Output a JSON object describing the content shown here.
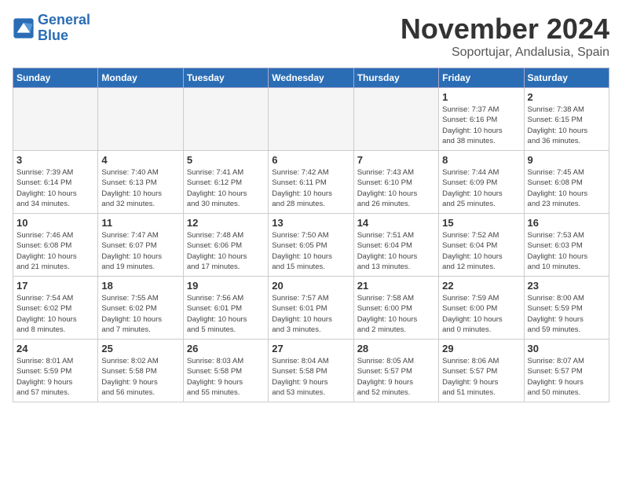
{
  "header": {
    "logo_line1": "General",
    "logo_line2": "Blue",
    "month": "November 2024",
    "location": "Soportujar, Andalusia, Spain"
  },
  "days_of_week": [
    "Sunday",
    "Monday",
    "Tuesday",
    "Wednesday",
    "Thursday",
    "Friday",
    "Saturday"
  ],
  "weeks": [
    [
      {
        "day": "",
        "info": ""
      },
      {
        "day": "",
        "info": ""
      },
      {
        "day": "",
        "info": ""
      },
      {
        "day": "",
        "info": ""
      },
      {
        "day": "",
        "info": ""
      },
      {
        "day": "1",
        "info": "Sunrise: 7:37 AM\nSunset: 6:16 PM\nDaylight: 10 hours\nand 38 minutes."
      },
      {
        "day": "2",
        "info": "Sunrise: 7:38 AM\nSunset: 6:15 PM\nDaylight: 10 hours\nand 36 minutes."
      }
    ],
    [
      {
        "day": "3",
        "info": "Sunrise: 7:39 AM\nSunset: 6:14 PM\nDaylight: 10 hours\nand 34 minutes."
      },
      {
        "day": "4",
        "info": "Sunrise: 7:40 AM\nSunset: 6:13 PM\nDaylight: 10 hours\nand 32 minutes."
      },
      {
        "day": "5",
        "info": "Sunrise: 7:41 AM\nSunset: 6:12 PM\nDaylight: 10 hours\nand 30 minutes."
      },
      {
        "day": "6",
        "info": "Sunrise: 7:42 AM\nSunset: 6:11 PM\nDaylight: 10 hours\nand 28 minutes."
      },
      {
        "day": "7",
        "info": "Sunrise: 7:43 AM\nSunset: 6:10 PM\nDaylight: 10 hours\nand 26 minutes."
      },
      {
        "day": "8",
        "info": "Sunrise: 7:44 AM\nSunset: 6:09 PM\nDaylight: 10 hours\nand 25 minutes."
      },
      {
        "day": "9",
        "info": "Sunrise: 7:45 AM\nSunset: 6:08 PM\nDaylight: 10 hours\nand 23 minutes."
      }
    ],
    [
      {
        "day": "10",
        "info": "Sunrise: 7:46 AM\nSunset: 6:08 PM\nDaylight: 10 hours\nand 21 minutes."
      },
      {
        "day": "11",
        "info": "Sunrise: 7:47 AM\nSunset: 6:07 PM\nDaylight: 10 hours\nand 19 minutes."
      },
      {
        "day": "12",
        "info": "Sunrise: 7:48 AM\nSunset: 6:06 PM\nDaylight: 10 hours\nand 17 minutes."
      },
      {
        "day": "13",
        "info": "Sunrise: 7:50 AM\nSunset: 6:05 PM\nDaylight: 10 hours\nand 15 minutes."
      },
      {
        "day": "14",
        "info": "Sunrise: 7:51 AM\nSunset: 6:04 PM\nDaylight: 10 hours\nand 13 minutes."
      },
      {
        "day": "15",
        "info": "Sunrise: 7:52 AM\nSunset: 6:04 PM\nDaylight: 10 hours\nand 12 minutes."
      },
      {
        "day": "16",
        "info": "Sunrise: 7:53 AM\nSunset: 6:03 PM\nDaylight: 10 hours\nand 10 minutes."
      }
    ],
    [
      {
        "day": "17",
        "info": "Sunrise: 7:54 AM\nSunset: 6:02 PM\nDaylight: 10 hours\nand 8 minutes."
      },
      {
        "day": "18",
        "info": "Sunrise: 7:55 AM\nSunset: 6:02 PM\nDaylight: 10 hours\nand 7 minutes."
      },
      {
        "day": "19",
        "info": "Sunrise: 7:56 AM\nSunset: 6:01 PM\nDaylight: 10 hours\nand 5 minutes."
      },
      {
        "day": "20",
        "info": "Sunrise: 7:57 AM\nSunset: 6:01 PM\nDaylight: 10 hours\nand 3 minutes."
      },
      {
        "day": "21",
        "info": "Sunrise: 7:58 AM\nSunset: 6:00 PM\nDaylight: 10 hours\nand 2 minutes."
      },
      {
        "day": "22",
        "info": "Sunrise: 7:59 AM\nSunset: 6:00 PM\nDaylight: 10 hours\nand 0 minutes."
      },
      {
        "day": "23",
        "info": "Sunrise: 8:00 AM\nSunset: 5:59 PM\nDaylight: 9 hours\nand 59 minutes."
      }
    ],
    [
      {
        "day": "24",
        "info": "Sunrise: 8:01 AM\nSunset: 5:59 PM\nDaylight: 9 hours\nand 57 minutes."
      },
      {
        "day": "25",
        "info": "Sunrise: 8:02 AM\nSunset: 5:58 PM\nDaylight: 9 hours\nand 56 minutes."
      },
      {
        "day": "26",
        "info": "Sunrise: 8:03 AM\nSunset: 5:58 PM\nDaylight: 9 hours\nand 55 minutes."
      },
      {
        "day": "27",
        "info": "Sunrise: 8:04 AM\nSunset: 5:58 PM\nDaylight: 9 hours\nand 53 minutes."
      },
      {
        "day": "28",
        "info": "Sunrise: 8:05 AM\nSunset: 5:57 PM\nDaylight: 9 hours\nand 52 minutes."
      },
      {
        "day": "29",
        "info": "Sunrise: 8:06 AM\nSunset: 5:57 PM\nDaylight: 9 hours\nand 51 minutes."
      },
      {
        "day": "30",
        "info": "Sunrise: 8:07 AM\nSunset: 5:57 PM\nDaylight: 9 hours\nand 50 minutes."
      }
    ]
  ]
}
